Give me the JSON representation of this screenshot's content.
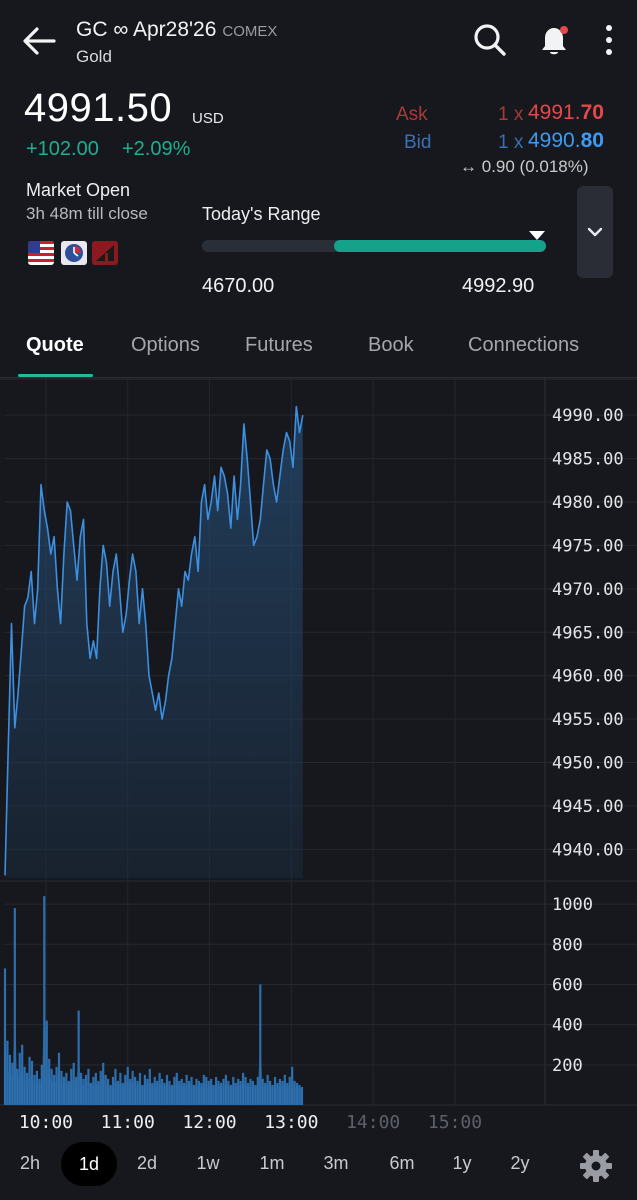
{
  "header": {
    "title": "GC ∞ Apr28'26",
    "exchange": "COMEX",
    "subtitle": "Gold"
  },
  "quote": {
    "last_price": "4991.50",
    "currency": "USD",
    "change": "+102.00",
    "change_pct": "+2.09%",
    "ask_label": "Ask",
    "ask_size": "1 x",
    "ask_price_main": "4991.",
    "ask_price_tail": "70",
    "bid_label": "Bid",
    "bid_size": "1 x",
    "bid_price_main": "4990.",
    "bid_price_tail": "80",
    "spread_icon": "↔",
    "spread": "0.90 (0.018%)"
  },
  "market": {
    "status": "Market Open",
    "till_close": "3h 48m till close",
    "range_label": "Today's Range",
    "range_low": "4670.00",
    "range_high": "4992.90",
    "range_fill_start": 0.385,
    "range_marker": 0.975
  },
  "tabs": [
    {
      "label": "Quote",
      "active": true
    },
    {
      "label": "Options"
    },
    {
      "label": "Futures"
    },
    {
      "label": "Book"
    },
    {
      "label": "Connections"
    }
  ],
  "chart_data": {
    "type": "area",
    "price_axis": {
      "ticks": [
        "4990.00",
        "4985.00",
        "4980.00",
        "4975.00",
        "4970.00",
        "4965.00",
        "4960.00",
        "4955.00",
        "4950.00",
        "4945.00",
        "4940.00"
      ],
      "ylim": [
        4936.7,
        4992.9
      ]
    },
    "volume_axis": {
      "ticks": [
        "1000",
        "800",
        "600",
        "400",
        "200"
      ],
      "ylim": [
        0,
        1100
      ]
    },
    "x_ticks": [
      {
        "label": "10:00",
        "active": true
      },
      {
        "label": "11:00",
        "active": true
      },
      {
        "label": "12:00",
        "active": true
      },
      {
        "label": "13:00",
        "active": true
      },
      {
        "label": "14:00",
        "active": false
      },
      {
        "label": "15:00",
        "active": false
      }
    ],
    "x_range_hours": [
      9.5,
      16.1
    ],
    "series": [
      {
        "type": "price",
        "x": [
          9.5,
          9.54,
          9.58,
          9.62,
          9.66,
          9.7,
          9.74,
          9.78,
          9.82,
          9.86,
          9.9,
          9.94,
          9.98,
          10.02,
          10.06,
          10.1,
          10.14,
          10.18,
          10.22,
          10.26,
          10.3,
          10.34,
          10.38,
          10.42,
          10.46,
          10.5,
          10.54,
          10.58,
          10.62,
          10.66,
          10.7,
          10.74,
          10.78,
          10.82,
          10.86,
          10.9,
          10.94,
          10.98,
          11.02,
          11.06,
          11.1,
          11.14,
          11.18,
          11.22,
          11.26,
          11.3,
          11.34,
          11.38,
          11.42,
          11.46,
          11.5,
          11.54,
          11.58,
          11.62,
          11.66,
          11.7,
          11.74,
          11.78,
          11.82,
          11.86,
          11.9,
          11.94,
          11.98,
          12.02,
          12.06,
          12.1,
          12.14,
          12.18,
          12.22,
          12.26,
          12.3,
          12.34,
          12.38,
          12.42,
          12.46,
          12.5,
          12.54,
          12.58,
          12.62,
          12.66,
          12.7,
          12.74,
          12.78,
          12.82,
          12.86,
          12.9,
          12.94,
          12.98,
          13.02,
          13.06,
          13.1,
          13.14
        ],
        "values": [
          4937,
          4952,
          4966,
          4954,
          4958,
          4963,
          4968,
          4969,
          4972,
          4966,
          4970,
          4982,
          4979,
          4977,
          4974,
          4976,
          4970,
          4966,
          4974,
          4980,
          4979,
          4975,
          4971,
          4976,
          4978,
          4966,
          4962,
          4964,
          4962,
          4970,
          4975,
          4973,
          4968,
          4972,
          4974,
          4970,
          4965,
          4967,
          4971,
          4974,
          4972,
          4966,
          4970,
          4966,
          4960,
          4958,
          4956,
          4958,
          4955,
          4957,
          4960,
          4962,
          4966,
          4970,
          4968,
          4972,
          4971,
          4974,
          4976,
          4972,
          4980,
          4982,
          4978,
          4980,
          4983,
          4979,
          4984,
          4983,
          4981,
          4977,
          4983,
          4978,
          4982,
          4989,
          4985,
          4980,
          4975,
          4976,
          4978,
          4982,
          4986,
          4985,
          4982,
          4980,
          4983,
          4986,
          4988,
          4987,
          4984,
          4991,
          4988,
          4990
        ]
      },
      {
        "type": "volume",
        "x": [
          9.5,
          9.53,
          9.56,
          9.59,
          9.62,
          9.65,
          9.68,
          9.71,
          9.74,
          9.77,
          9.8,
          9.83,
          9.86,
          9.89,
          9.92,
          9.95,
          9.98,
          10.01,
          10.04,
          10.07,
          10.1,
          10.13,
          10.16,
          10.19,
          10.22,
          10.25,
          10.28,
          10.31,
          10.34,
          10.37,
          10.4,
          10.43,
          10.46,
          10.49,
          10.52,
          10.55,
          10.58,
          10.61,
          10.64,
          10.67,
          10.7,
          10.73,
          10.76,
          10.79,
          10.82,
          10.85,
          10.88,
          10.91,
          10.94,
          10.97,
          11.0,
          11.03,
          11.06,
          11.09,
          11.12,
          11.15,
          11.18,
          11.21,
          11.24,
          11.27,
          11.3,
          11.33,
          11.36,
          11.39,
          11.42,
          11.45,
          11.48,
          11.51,
          11.54,
          11.57,
          11.6,
          11.63,
          11.66,
          11.69,
          11.72,
          11.75,
          11.78,
          11.81,
          11.84,
          11.87,
          11.9,
          11.93,
          11.96,
          11.99,
          12.02,
          12.05,
          12.08,
          12.11,
          12.14,
          12.17,
          12.2,
          12.23,
          12.26,
          12.29,
          12.32,
          12.35,
          12.38,
          12.41,
          12.44,
          12.47,
          12.5,
          12.53,
          12.56,
          12.59,
          12.62,
          12.65,
          12.68,
          12.71,
          12.74,
          12.77,
          12.8,
          12.83,
          12.86,
          12.89,
          12.92,
          12.95,
          12.98,
          13.01,
          13.04,
          13.07,
          13.1,
          13.13
        ],
        "values": [
          680,
          320,
          250,
          210,
          980,
          180,
          260,
          300,
          190,
          160,
          240,
          220,
          150,
          170,
          130,
          200,
          1040,
          420,
          230,
          180,
          150,
          190,
          260,
          170,
          140,
          160,
          120,
          180,
          210,
          140,
          470,
          160,
          130,
          150,
          180,
          110,
          140,
          160,
          120,
          170,
          210,
          150,
          130,
          100,
          140,
          180,
          120,
          160,
          110,
          150,
          190,
          130,
          170,
          140,
          120,
          160,
          100,
          150,
          130,
          180,
          110,
          140,
          120,
          160,
          130,
          110,
          150,
          120,
          100,
          140,
          160,
          120,
          130,
          110,
          150,
          120,
          140,
          100,
          130,
          120,
          110,
          150,
          140,
          120,
          130,
          100,
          140,
          120,
          110,
          130,
          150,
          120,
          100,
          140,
          110,
          130,
          120,
          160,
          140,
          110,
          130,
          120,
          100,
          140,
          600,
          130,
          110,
          150,
          120,
          100,
          140,
          110,
          130,
          120,
          150,
          110,
          140,
          190,
          120,
          110,
          100,
          90
        ]
      }
    ]
  },
  "timeframes": [
    {
      "label": "2h"
    },
    {
      "label": "1d",
      "active": true
    },
    {
      "label": "2d"
    },
    {
      "label": "1w"
    },
    {
      "label": "1m"
    },
    {
      "label": "3m"
    },
    {
      "label": "6m"
    },
    {
      "label": "1y"
    },
    {
      "label": "2y"
    }
  ],
  "colors": {
    "up": "#1fae8f",
    "ask": "#e5484a",
    "bid": "#3d9bf3",
    "accent": "#27b79a",
    "price_line": "#3d8fe0",
    "volume": "#2d6fae"
  }
}
